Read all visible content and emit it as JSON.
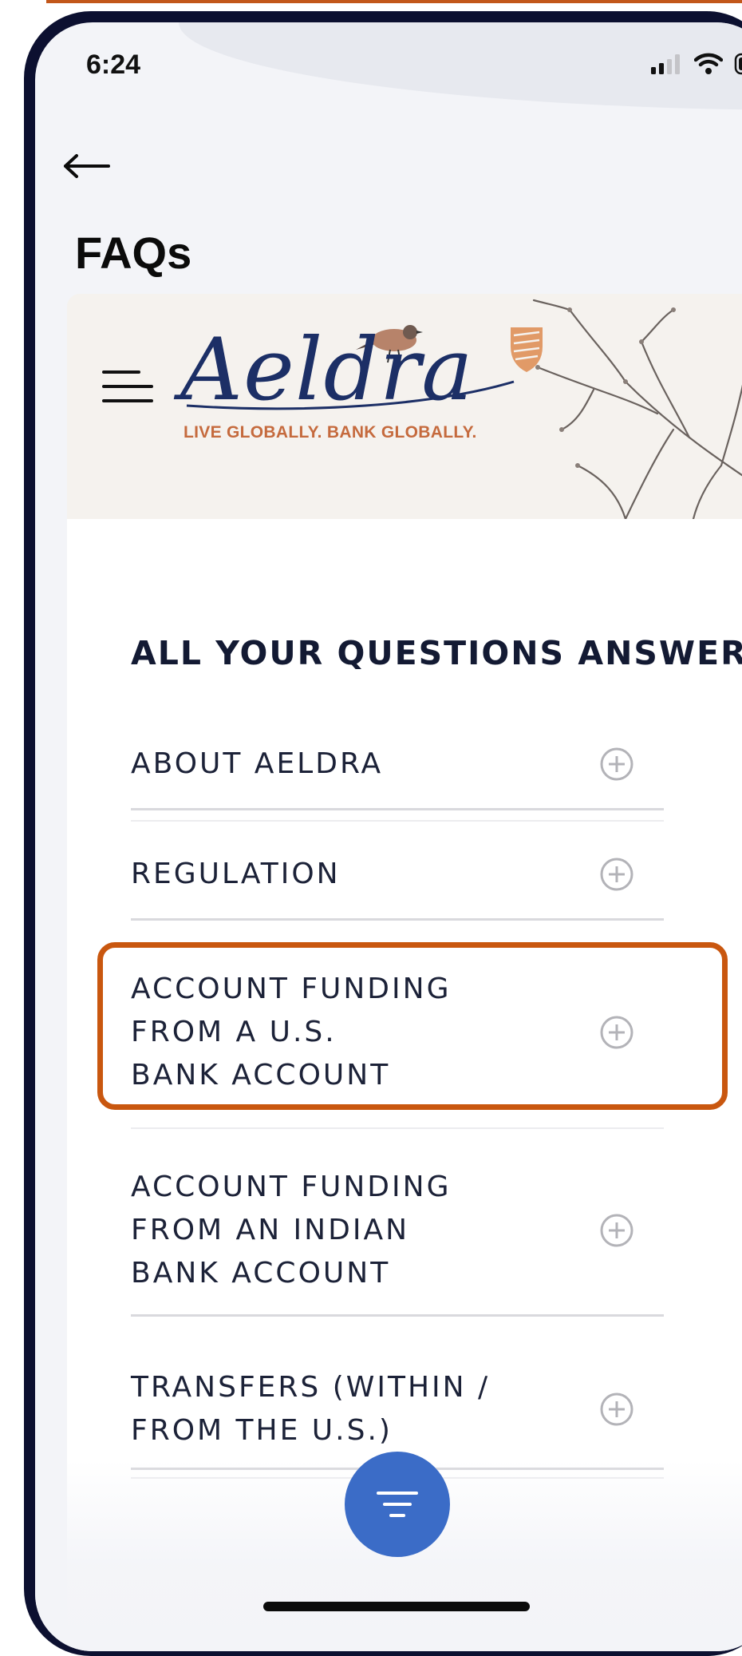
{
  "status_bar": {
    "time": "6:24"
  },
  "header": {
    "title": "FAQs"
  },
  "banner": {
    "brand_name": "Aeldra",
    "tagline": "LIVE GLOBALLY. BANK GLOBALLY."
  },
  "faq": {
    "heading": "ALL YOUR QUESTIONS ANSWERED",
    "items": [
      {
        "label": "ABOUT AELDRA"
      },
      {
        "label": "REGULATION"
      },
      {
        "label": "ACCOUNT FUNDING\nFROM A U.S.\nBANK ACCOUNT"
      },
      {
        "label": "ACCOUNT FUNDING\nFROM AN INDIAN\nBANK ACCOUNT"
      },
      {
        "label": "TRANSFERS (WITHIN /\nFROM THE U.S.)"
      }
    ]
  },
  "colors": {
    "accent_highlight": "#c9570f",
    "brand_navy": "#1c2f66",
    "brand_orange": "#c56a3d",
    "fab_blue": "#3b6cc7"
  }
}
